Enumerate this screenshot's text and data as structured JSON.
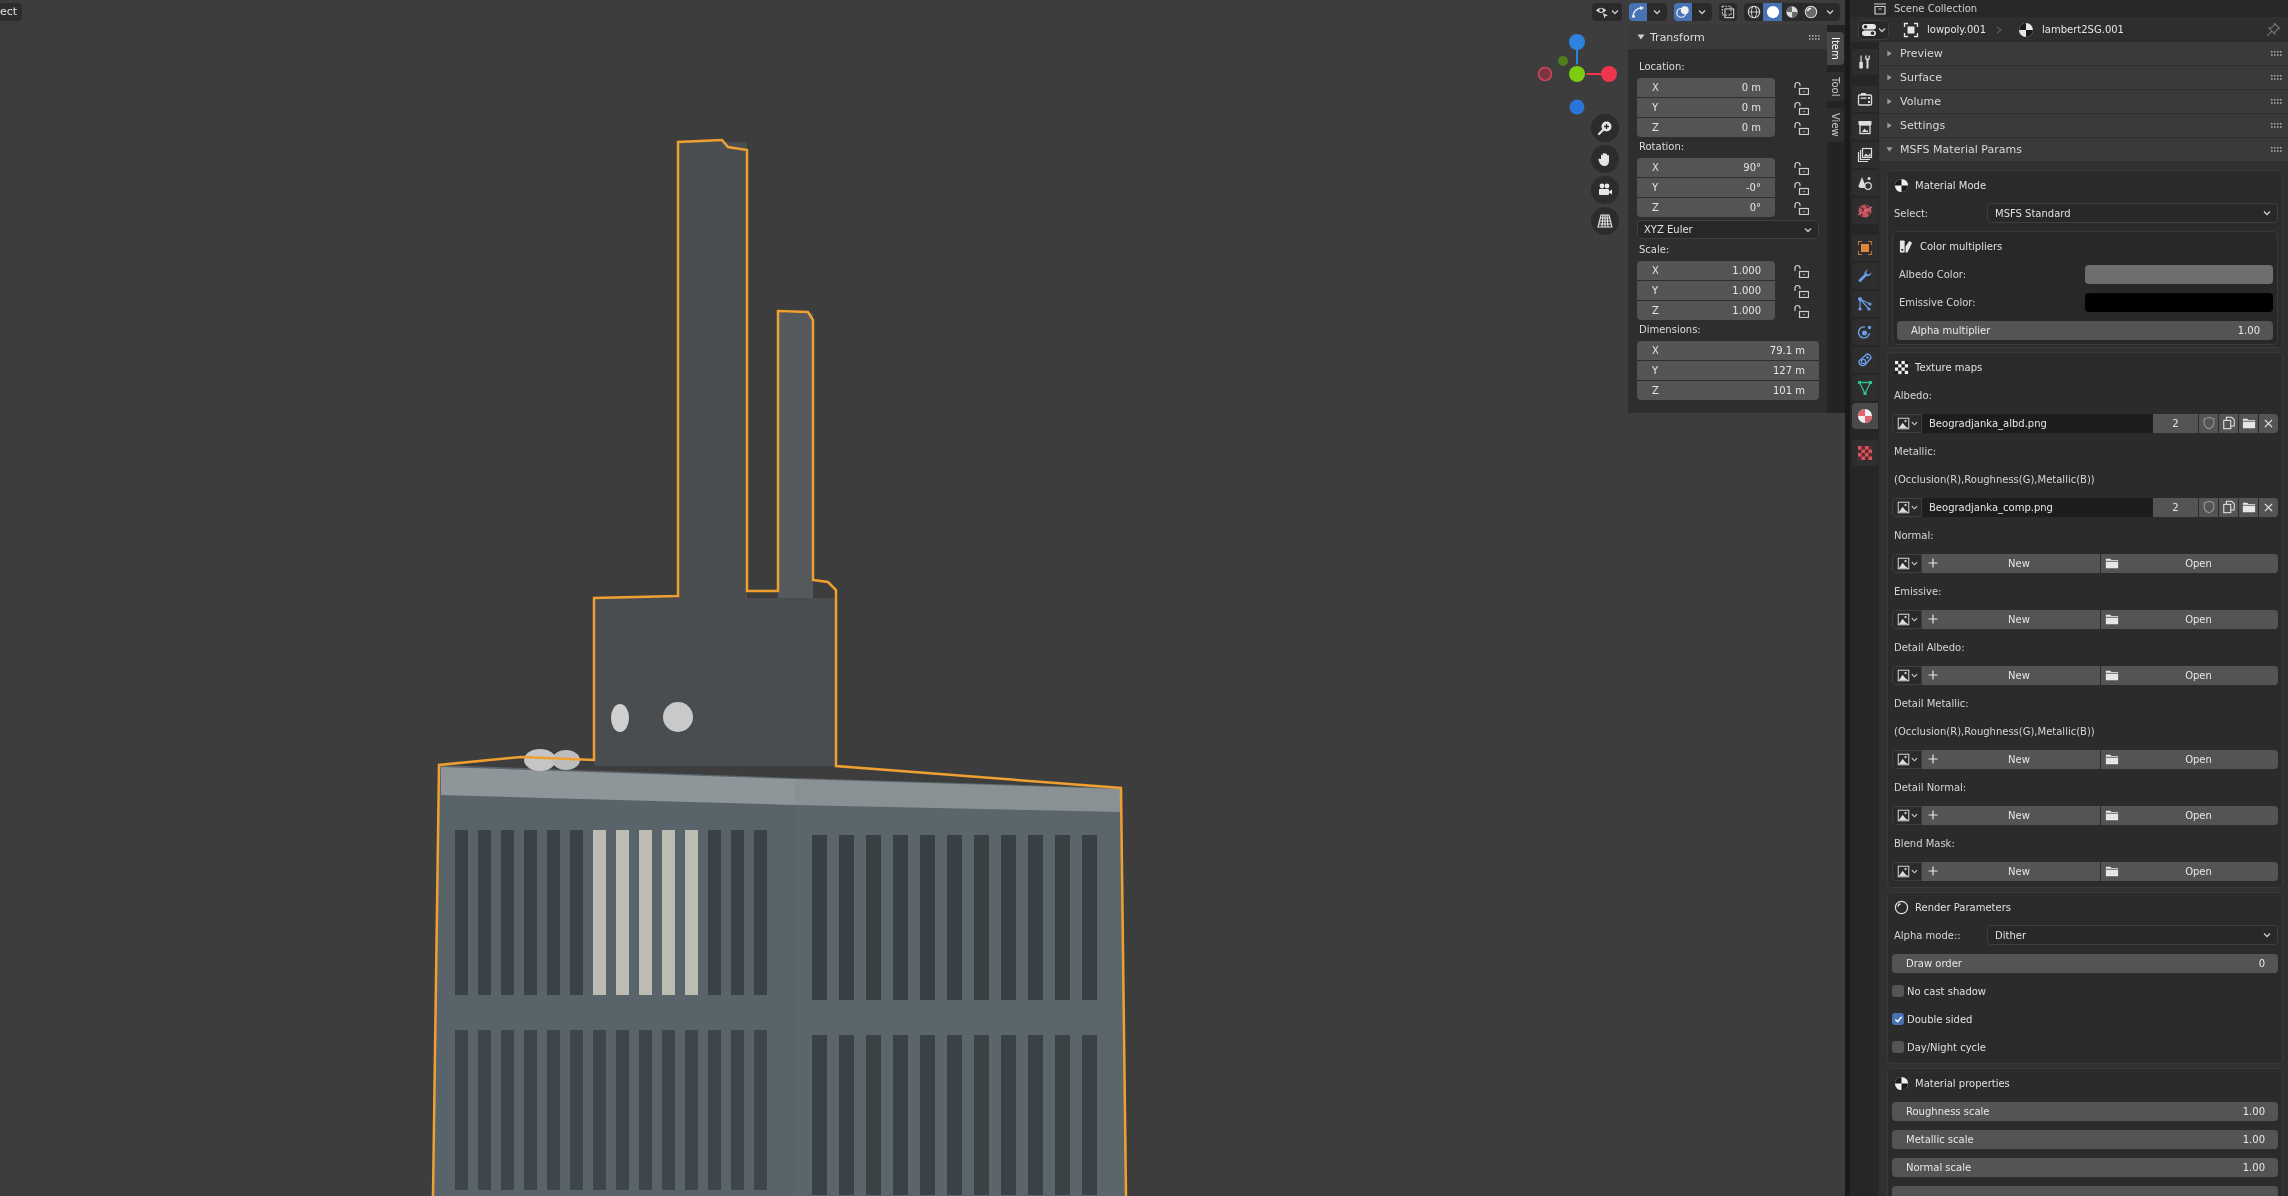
{
  "viewport": {
    "header_menu": {
      "label": "ect"
    },
    "header": {
      "gizmos_on": true,
      "overlays_on": true,
      "xray_on": false,
      "shading": [
        {
          "kind": "wireframe",
          "selected": false
        },
        {
          "kind": "solid",
          "selected": true
        },
        {
          "kind": "material",
          "selected": false
        },
        {
          "kind": "rendered",
          "selected": false
        }
      ]
    },
    "sidebar_tabs": [
      {
        "label": "Item",
        "selected": true
      },
      {
        "label": "Tool",
        "selected": false
      },
      {
        "label": "View",
        "selected": false
      }
    ],
    "transform": {
      "title": "Transform",
      "expanded": true,
      "groups": [
        {
          "kind": "vector",
          "label": "Location:",
          "fields": [
            {
              "axis": "X",
              "value": "0 m",
              "locked": false
            },
            {
              "axis": "Y",
              "value": "0 m",
              "locked": false
            },
            {
              "axis": "Z",
              "value": "0 m",
              "locked": false
            }
          ]
        },
        {
          "kind": "vector",
          "label": "Rotation:",
          "fields": [
            {
              "axis": "X",
              "value": "90°",
              "locked": false
            },
            {
              "axis": "Y",
              "value": "-0°",
              "locked": false
            },
            {
              "axis": "Z",
              "value": "0°",
              "locked": false
            }
          ]
        },
        {
          "kind": "dropdown",
          "value": "XYZ Euler"
        },
        {
          "kind": "vector",
          "label": "Scale:",
          "fields": [
            {
              "axis": "X",
              "value": "1.000",
              "locked": false
            },
            {
              "axis": "Y",
              "value": "1.000",
              "locked": false
            },
            {
              "axis": "Z",
              "value": "1.000",
              "locked": false
            }
          ]
        },
        {
          "kind": "vector",
          "label": "Dimensions:",
          "fields": [
            {
              "axis": "X",
              "value": "79.1 m"
            },
            {
              "axis": "Y",
              "value": "127 m"
            },
            {
              "axis": "Z",
              "value": "101 m"
            }
          ]
        }
      ]
    }
  },
  "outliner": {
    "title": "Scene Collection"
  },
  "properties": {
    "header": {
      "object": "lowpoly.001",
      "material": "lambert2SG.001",
      "pinned": false
    },
    "tabs": [
      {
        "kind": "tool",
        "selected": false
      },
      {
        "kind": "render",
        "selected": false
      },
      {
        "kind": "output",
        "selected": false
      },
      {
        "kind": "view_layer",
        "selected": false
      },
      {
        "kind": "scene",
        "selected": false
      },
      {
        "kind": "world",
        "selected": false
      },
      {
        "kind": "object",
        "selected": false
      },
      {
        "kind": "modifiers",
        "selected": false
      },
      {
        "kind": "particles",
        "selected": false
      },
      {
        "kind": "physics",
        "selected": false
      },
      {
        "kind": "constraints",
        "selected": false
      },
      {
        "kind": "data",
        "selected": false
      },
      {
        "kind": "material",
        "selected": true
      },
      {
        "kind": "texture",
        "selected": false
      }
    ],
    "panels": [
      {
        "title": "Preview",
        "expanded": false
      },
      {
        "title": "Surface",
        "expanded": false
      },
      {
        "title": "Volume",
        "expanded": false
      },
      {
        "title": "Settings",
        "expanded": false
      },
      {
        "title": "MSFS Material Params",
        "expanded": true,
        "sections": [
          {
            "kind": "material_mode",
            "title": "Material Mode",
            "rows": [
              {
                "kind": "dropdown",
                "label": "Select:",
                "value": "MSFS Standard"
              }
            ],
            "subsections": [
              {
                "kind": "color_multipliers",
                "title": "Color multipliers",
                "rows": [
                  {
                    "kind": "color",
                    "label": "Albedo Color:",
                    "color": "#6e6e6e"
                  },
                  {
                    "kind": "color",
                    "label": "Emissive Color:",
                    "color": "#000000"
                  },
                  {
                    "kind": "number",
                    "label": "Alpha multiplier",
                    "value": "1.00"
                  }
                ]
              }
            ]
          },
          {
            "kind": "texture_maps",
            "title": "Texture maps",
            "rows": [
              {
                "kind": "label",
                "text": "Albedo:"
              },
              {
                "kind": "image",
                "file": "Beogradjanka_albd.png",
                "users": "2"
              },
              {
                "kind": "label",
                "text": "Metallic:"
              },
              {
                "kind": "label",
                "text": "(Occlusion(R),Roughness(G),Metallic(B))"
              },
              {
                "kind": "image",
                "file": "Beogradjanka_comp.png",
                "users": "2"
              },
              {
                "kind": "label",
                "text": "Normal:"
              },
              {
                "kind": "image_empty",
                "new": "New",
                "open": "Open"
              },
              {
                "kind": "label",
                "text": "Emissive:"
              },
              {
                "kind": "image_empty",
                "new": "New",
                "open": "Open"
              },
              {
                "kind": "label",
                "text": "Detail Albedo:"
              },
              {
                "kind": "image_empty",
                "new": "New",
                "open": "Open"
              },
              {
                "kind": "label",
                "text": "Detail Metallic:"
              },
              {
                "kind": "label",
                "text": "(Occlusion(R),Roughness(G),Metallic(B))"
              },
              {
                "kind": "image_empty",
                "new": "New",
                "open": "Open"
              },
              {
                "kind": "label",
                "text": "Detail Normal:"
              },
              {
                "kind": "image_empty",
                "new": "New",
                "open": "Open"
              },
              {
                "kind": "label",
                "text": "Blend Mask:"
              },
              {
                "kind": "image_empty",
                "new": "New",
                "open": "Open"
              }
            ]
          },
          {
            "kind": "render_parameters",
            "title": "Render Parameters",
            "rows": [
              {
                "kind": "dropdown",
                "label": "Alpha mode::",
                "value": "Dither"
              },
              {
                "kind": "number",
                "label": "Draw order",
                "value": "0"
              },
              {
                "kind": "checkbox",
                "label": "No cast shadow",
                "checked": false
              },
              {
                "kind": "checkbox",
                "label": "Double sided",
                "checked": true
              },
              {
                "kind": "checkbox",
                "label": "Day/Night cycle",
                "checked": false
              }
            ]
          },
          {
            "kind": "material_properties",
            "title": "Material properties",
            "rows": [
              {
                "kind": "number",
                "label": "Roughness scale",
                "value": "1.00"
              },
              {
                "kind": "number",
                "label": "Metallic scale",
                "value": "1.00"
              },
              {
                "kind": "number",
                "label": "Normal scale",
                "value": "1.00"
              },
              {
                "kind": "number"
              }
            ]
          }
        ]
      }
    ]
  }
}
